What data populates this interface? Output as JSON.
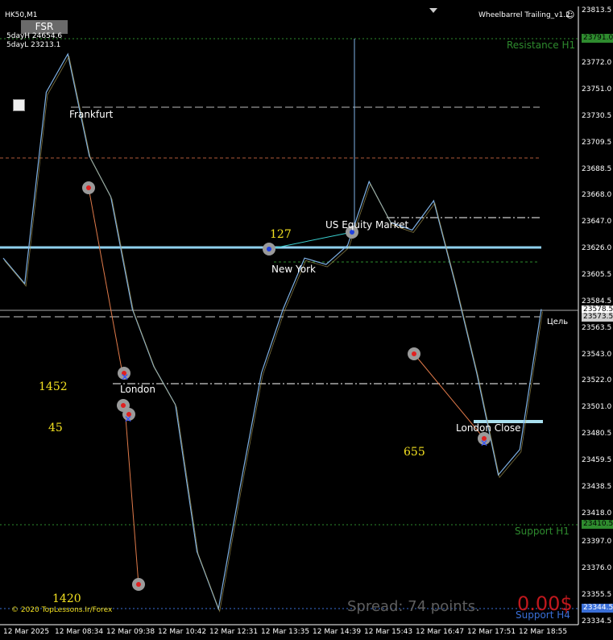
{
  "window": {
    "symbol_label": "HK50,M1",
    "indicator_name": "Wheelbarrel Trailing_v1.2",
    "fsr_button": "FSR",
    "day_high": "5dayH 24654.6",
    "day_low": "5dayL 23213.1"
  },
  "sessions": {
    "frankfurt": "Frankfurt",
    "london": "London",
    "new_york": "New York",
    "us_equity": "US Equity Market",
    "london_close": "London Close"
  },
  "levels": {
    "resistance": "Resistance H1",
    "support_h1": "Support H1",
    "support_h4": "Support H4",
    "target": "Цель"
  },
  "counters": {
    "c1452": "1452",
    "c45": "45",
    "c1420": "1420",
    "c127": "127",
    "c655": "655"
  },
  "footer": {
    "copyright": "© 2020 TopLessons.Ir/Forex",
    "spread": "Spread: 74 points.",
    "profit": "0.00$"
  },
  "price_axis": {
    "ticks": [
      "23813.5",
      "23772.0",
      "23751.0",
      "23730.5",
      "23709.5",
      "23688.5",
      "23668.0",
      "23647.0",
      "23626.0",
      "23605.5",
      "23584.5",
      "23563.5",
      "23543.0",
      "23522.0",
      "23501.0",
      "23480.5",
      "23459.5",
      "23438.5",
      "23418.0",
      "23397.0",
      "23376.0",
      "23355.5",
      "23334.5"
    ],
    "tag_resistance": "23791.0",
    "tag_current": "23578.5",
    "tag_target": "23573.5",
    "tag_support_h1": "23410.5",
    "tag_support_h4": "23344.5"
  },
  "time_axis": [
    "12 Mar 2025",
    "12 Mar 08:34",
    "12 Mar 09:38",
    "12 Mar 10:42",
    "12 Mar 12:31",
    "12 Mar 13:35",
    "12 Mar 14:39",
    "12 Mar 15:43",
    "12 Mar 16:47",
    "12 Mar 17:51",
    "12 Mar 18:55"
  ],
  "colors": {
    "background": "#000000",
    "resistance": "#2e8b2e",
    "support_h4": "#3a6fd8",
    "level_line": "#7fc7e8",
    "profit": "#c0181d",
    "counter": "#f2e020"
  },
  "chart_data": {
    "type": "line",
    "ylim": [
      23334.5,
      23813.5
    ],
    "x": [
      0,
      4,
      8,
      12,
      16,
      20,
      24,
      28,
      32,
      36,
      40,
      44,
      48,
      52,
      56,
      60,
      64,
      68,
      72,
      76,
      80,
      84,
      88,
      92,
      96,
      100
    ],
    "series": [
      {
        "values": [
          23620,
          23600,
          23750,
          23780,
          23700,
          23668,
          23580,
          23535,
          23505,
          23390,
          23345,
          23440,
          23530,
          23580,
          23620,
          23615,
          23630,
          23680,
          23648,
          23642,
          23665,
          23600,
          23530,
          23450,
          23470,
          23580
        ]
      }
    ]
  }
}
